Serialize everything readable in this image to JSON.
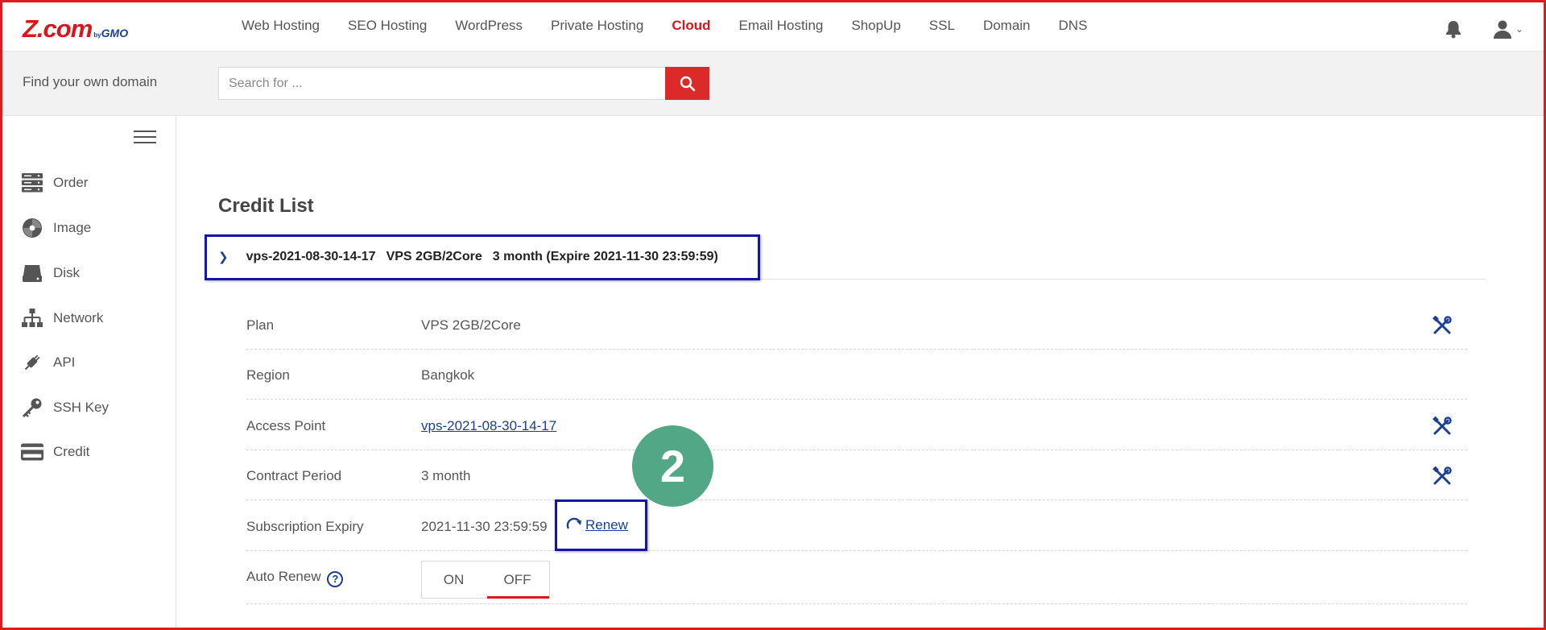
{
  "brand": {
    "name": "Z.com",
    "by": "by",
    "gmo": "GMO",
    "accent": "#d7161e",
    "link": "#1c3f94"
  },
  "nav": {
    "items": [
      "Web Hosting",
      "SEO Hosting",
      "WordPress",
      "Private Hosting",
      "Cloud",
      "Email Hosting",
      "ShopUp",
      "SSL",
      "Domain",
      "DNS"
    ],
    "active": "Cloud",
    "icons": [
      "bell-icon",
      "user-icon"
    ]
  },
  "search": {
    "label": "Find your own domain",
    "placeholder": "Search for ..."
  },
  "sidebar": {
    "items": [
      {
        "label": "Order",
        "icon": "server-stack-icon"
      },
      {
        "label": "Image",
        "icon": "disc-icon"
      },
      {
        "label": "Disk",
        "icon": "hard-disk-icon"
      },
      {
        "label": "Network",
        "icon": "network-icon"
      },
      {
        "label": "API",
        "icon": "api-plug-icon"
      },
      {
        "label": "SSH Key",
        "icon": "key-icon"
      },
      {
        "label": "Credit",
        "icon": "credit-card-icon"
      }
    ]
  },
  "main": {
    "title": "Credit List",
    "accordion": {
      "name": "vps-2021-08-30-14-17",
      "plan": "VPS 2GB/2Core",
      "period": "3 month (Expire 2021-11-30 23:59:59)"
    },
    "rows": [
      {
        "key": "Plan",
        "value": "VPS 2GB/2Core"
      },
      {
        "key": "Region",
        "value": "Bangkok"
      },
      {
        "key": "Access Point",
        "value": "vps-2021-08-30-14-17"
      },
      {
        "key": "Contract Period",
        "value": "3 month"
      },
      {
        "key": "Subscription Expiry",
        "value": "2021-11-30 23:59:59"
      }
    ],
    "renew_label": "Renew",
    "auto_renew": {
      "label": "Auto Renew",
      "help": "?",
      "on": "ON",
      "off": "OFF",
      "selected": "OFF"
    }
  },
  "annotation": {
    "step": "2",
    "color": "#52a886",
    "highlight": "#1515a8"
  }
}
